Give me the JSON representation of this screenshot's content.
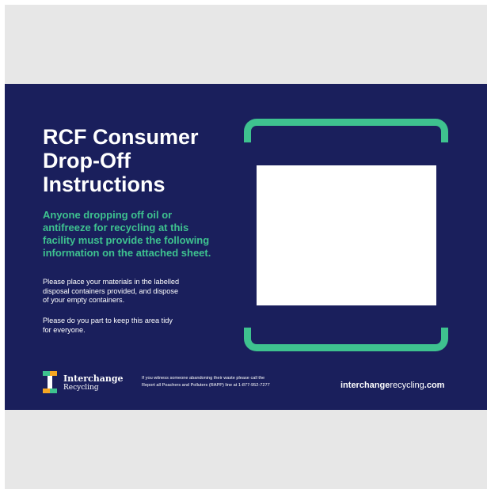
{
  "sign": {
    "title_lines": [
      "RCF Consumer",
      "Drop-Off",
      "Instructions"
    ],
    "lead_lines": [
      "Anyone dropping off oil or",
      "antifreeze for recycling at this",
      "facility must provide the following",
      "information on the attached sheet."
    ],
    "paragraph1_lines": [
      "Please place your materials in the labelled",
      "disposal containers provided, and dispose",
      "of your empty containers."
    ],
    "paragraph2_lines": [
      "Please do you part to keep this area tidy",
      "for everyone."
    ]
  },
  "footer": {
    "logo_name": "Interchange",
    "logo_sub": "Recycling",
    "note_lines": [
      "If you witness someone abandoning their waste please call the",
      "Report all Poachers and Polluters (RAPP) line at 1-877-952-7277"
    ],
    "website_bold": "interchange",
    "website_light": "recycling",
    "website_tld": ".com"
  },
  "colors": {
    "background": "#1a1f5c",
    "accent": "#3ec28f",
    "frame": "#e7e7e7",
    "text": "#ffffff"
  },
  "icons": {
    "logo": "interchange-logo-icon"
  }
}
